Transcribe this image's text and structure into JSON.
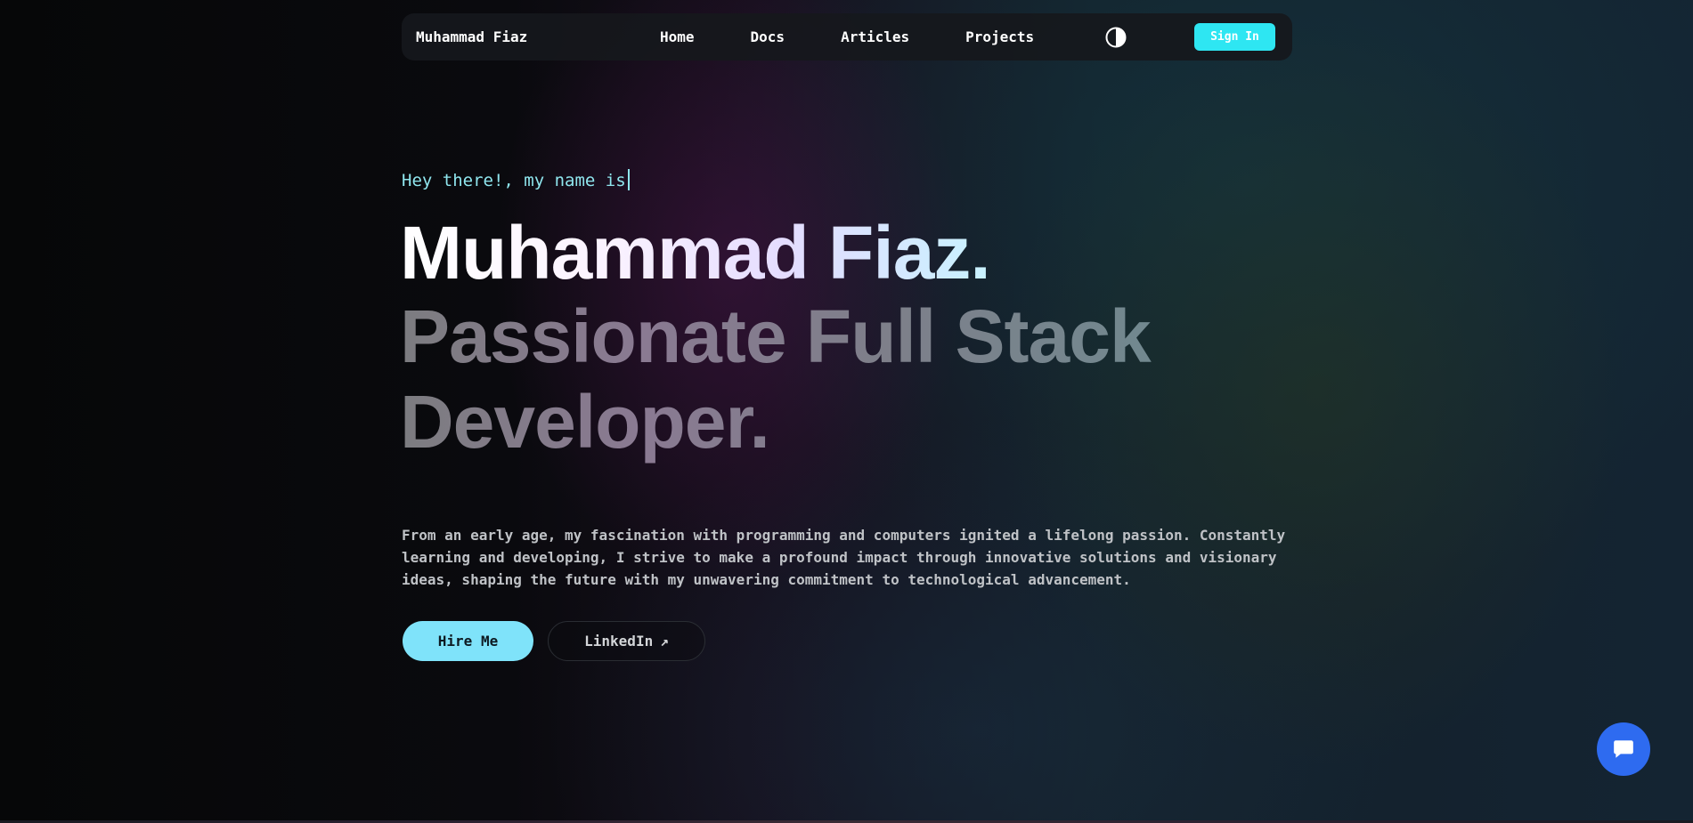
{
  "nav": {
    "brand": "Muhammad Fiaz",
    "links": [
      {
        "label": "Home"
      },
      {
        "label": "Docs"
      },
      {
        "label": "Articles"
      },
      {
        "label": "Projects"
      }
    ],
    "theme_toggle_icon": "contrast-icon",
    "signin_label": "Sign In"
  },
  "hero": {
    "greeting": "Hey there!, my name is",
    "name": "Muhammad Fiaz.",
    "role": "Passionate Full Stack Developer.",
    "bio": "From an early age, my fascination with programming and computers ignited a lifelong passion. Constantly learning and developing, I strive to make a profound impact through innovative solutions and visionary ideas, shaping the future with my unwavering commitment to technological advancement.",
    "hire_label": "Hire Me",
    "linkedin_label": "LinkedIn",
    "linkedin_icon": "external-arrow-icon"
  },
  "chat": {
    "icon": "chat-bubble-icon"
  },
  "colors": {
    "accent": "#2ee6f2",
    "hire_button": "#7fe3fa",
    "chat_button": "#2e6bf0",
    "greeting": "#8fe6ee"
  }
}
